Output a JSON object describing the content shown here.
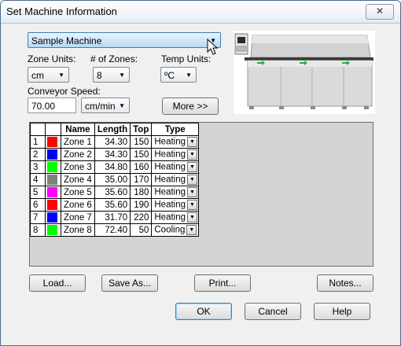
{
  "window": {
    "title": "Set Machine Information",
    "close_glyph": "✕"
  },
  "machine": {
    "selected": "Sample Machine"
  },
  "zone_units": {
    "label": "Zone Units:",
    "value": "cm"
  },
  "num_zones": {
    "label": "# of Zones:",
    "value": "8"
  },
  "temp_units": {
    "label": "Temp Units:",
    "value": "ºC"
  },
  "conveyor": {
    "label": "Conveyor Speed:",
    "value": "70.00",
    "unit": "cm/min"
  },
  "more_button": "More >>",
  "grid": {
    "headers": [
      "",
      "",
      "Name",
      "Length",
      "Top",
      "Type"
    ],
    "rows": [
      {
        "n": "1",
        "color": "#ff0000",
        "name": "Zone 1",
        "length": "34.30",
        "top": "150",
        "type": "Heating"
      },
      {
        "n": "2",
        "color": "#0000ff",
        "name": "Zone 2",
        "length": "34.30",
        "top": "150",
        "type": "Heating"
      },
      {
        "n": "3",
        "color": "#00ff00",
        "name": "Zone 3",
        "length": "34.80",
        "top": "160",
        "type": "Heating"
      },
      {
        "n": "4",
        "color": "#808080",
        "name": "Zone 4",
        "length": "35.00",
        "top": "170",
        "type": "Heating"
      },
      {
        "n": "5",
        "color": "#ff00ff",
        "name": "Zone 5",
        "length": "35.60",
        "top": "180",
        "type": "Heating"
      },
      {
        "n": "6",
        "color": "#ff0000",
        "name": "Zone 6",
        "length": "35.60",
        "top": "190",
        "type": "Heating"
      },
      {
        "n": "7",
        "color": "#0000ff",
        "name": "Zone 7",
        "length": "31.70",
        "top": "220",
        "type": "Heating"
      },
      {
        "n": "8",
        "color": "#00ff00",
        "name": "Zone 8",
        "length": "72.40",
        "top": "50",
        "type": "Cooling"
      }
    ]
  },
  "buttons": {
    "load": "Load...",
    "save_as": "Save As...",
    "print": "Print...",
    "notes": "Notes...",
    "ok": "OK",
    "cancel": "Cancel",
    "help": "Help"
  },
  "colors": {
    "accent": "#3c7fb1",
    "conveyor_arrow": "#1db33a"
  }
}
